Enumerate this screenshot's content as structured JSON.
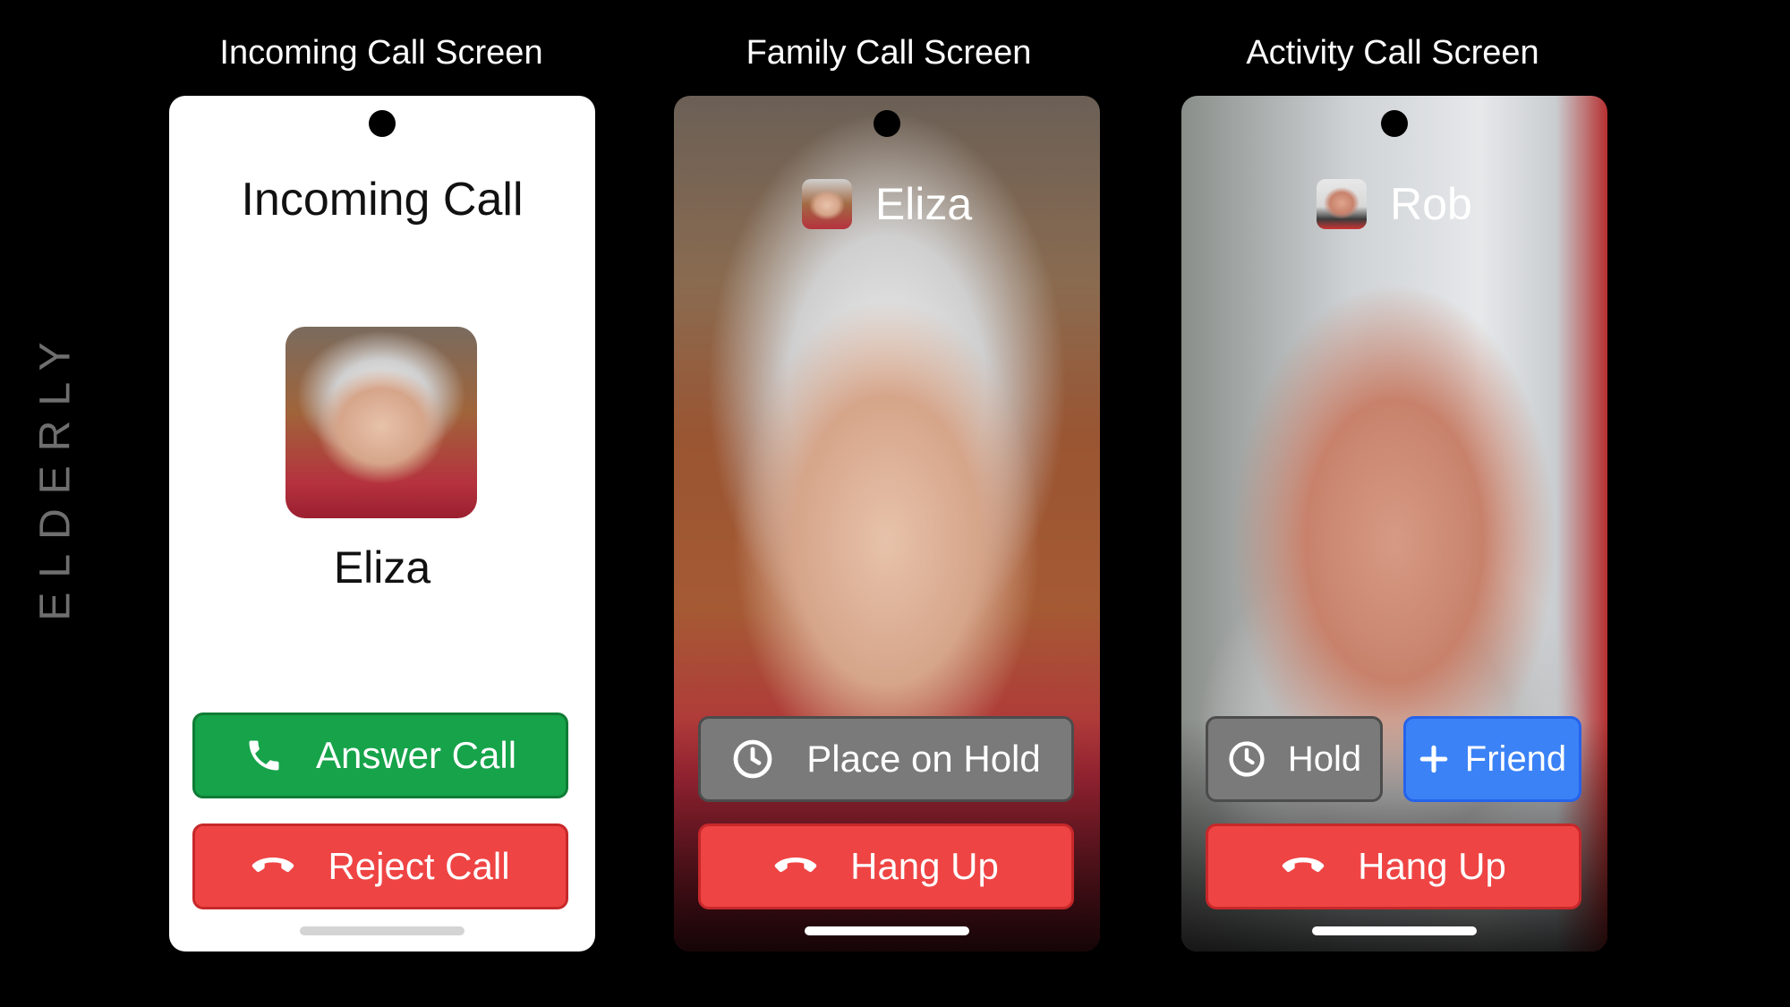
{
  "side_label": "ELDERLY",
  "screens": {
    "incoming": {
      "title": "Incoming Call Screen",
      "heading": "Incoming Call",
      "caller_name": "Eliza",
      "answer_label": "Answer Call",
      "reject_label": "Reject Call"
    },
    "family": {
      "title": "Family Call Screen",
      "caller_name": "Eliza",
      "hold_label": "Place on Hold",
      "hangup_label": "Hang Up"
    },
    "activity": {
      "title": "Activity Call Screen",
      "caller_name": "Rob",
      "hold_label": "Hold",
      "friend_label": "Friend",
      "hangup_label": "Hang Up"
    }
  },
  "icons": {
    "answer": "phone-icon",
    "reject": "phone-hangup-icon",
    "hold": "clock-icon",
    "friend": "plus-icon"
  },
  "colors": {
    "answer": "#16a34a",
    "reject": "#ef4444",
    "hold": "#7a7a7a",
    "friend": "#3b82f6"
  }
}
